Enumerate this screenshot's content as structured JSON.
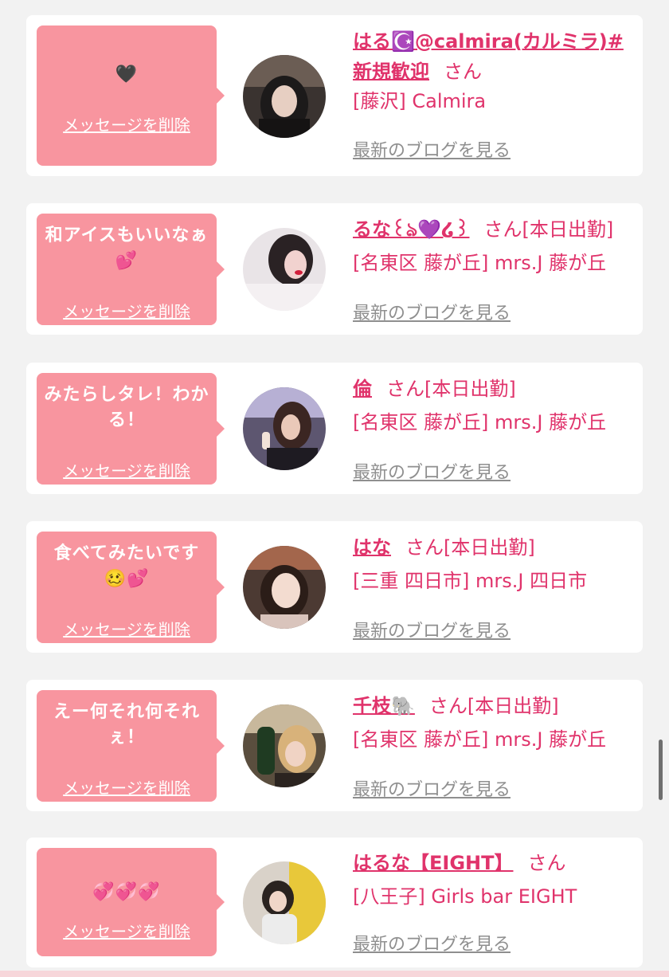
{
  "colors": {
    "bubble": "#f8959f",
    "accent": "#e0336b",
    "link_gray": "#8f8f8f",
    "background": "#f2f2f2"
  },
  "delete_label": "メッセージを削除",
  "blog_label": "最新のブログを見る",
  "san_label": "さん",
  "cards": [
    {
      "message": "🖤",
      "name": "はる☪️@calmira(カルミラ)#新規歓迎",
      "tag": "",
      "shop": "[藤沢] Calmira"
    },
    {
      "message": "和アイスもいいなぁ💕",
      "name": "るな꒰ঌ💜໒꒱",
      "tag": "[本日出勤]",
      "shop": "[名東区 藤が丘] mrs.J 藤が丘"
    },
    {
      "message": "みたらしタレ！わかる！",
      "name": "倫",
      "tag": "[本日出勤]",
      "shop": "[名東区 藤が丘] mrs.J 藤が丘"
    },
    {
      "message": "食べてみたいです🥴💕",
      "name": "はな",
      "tag": "[本日出勤]",
      "shop": "[三重 四日市] mrs.J 四日市"
    },
    {
      "message": "えー何それ何それぇ！",
      "name": "千枝🐘",
      "tag": "[本日出勤]",
      "shop": "[名東区 藤が丘] mrs.J 藤が丘"
    },
    {
      "message": "💞💞💞",
      "name": "はるな【EIGHT】",
      "tag": "",
      "shop": "[八王子] Girls bar EIGHT"
    }
  ]
}
